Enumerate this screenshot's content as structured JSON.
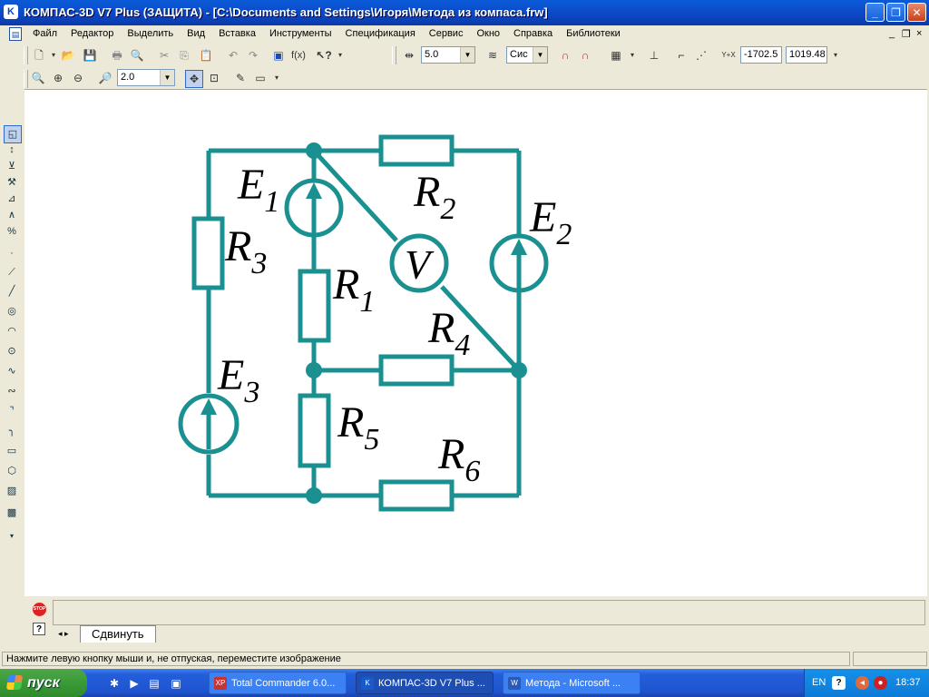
{
  "window": {
    "title": "КОМПАС-3D V7 Plus (ЗАЩИТА) - [C:\\Documents and Settings\\Игоря\\Метода из компаса.frw]",
    "app_icon": "K",
    "minimize": "_",
    "maximize": "❐",
    "close": "✕"
  },
  "menu": {
    "items": [
      "Файл",
      "Редактор",
      "Выделить",
      "Вид",
      "Вставка",
      "Инструменты",
      "Спецификация",
      "Сервис",
      "Окно",
      "Справка",
      "Библиотеки"
    ],
    "mdi_minimize": "_",
    "mdi_restore": "❐",
    "mdi_close": "×"
  },
  "toolbar1": {
    "step_value": "5.0",
    "layer_value": "Сис",
    "coord_x_label": "Y+X",
    "coord_x": "-1702.5",
    "coord_y": "1019.48",
    "fx_label": "f(x)"
  },
  "toolbar2": {
    "zoom_value": "2.0"
  },
  "circuit": {
    "line_color": "#1a9090",
    "labels": {
      "e1": "E",
      "e1_sub": "1",
      "e2": "E",
      "e2_sub": "2",
      "e3": "E",
      "e3_sub": "3",
      "r1": "R",
      "r1_sub": "1",
      "r2": "R",
      "r2_sub": "2",
      "r3": "R",
      "r3_sub": "3",
      "r4": "R",
      "r4_sub": "4",
      "r5": "R",
      "r5_sub": "5",
      "r6": "R",
      "r6_sub": "6",
      "voltmeter": "V"
    }
  },
  "command": {
    "stop_label": "STOP",
    "help_label": "?",
    "nav": "◂ ▸",
    "tab_label": "Сдвинуть"
  },
  "status": {
    "text": "Нажмите левую кнопку мыши и, не отпуская, переместите изображение"
  },
  "taskbar": {
    "start_label": "пуск",
    "tasks": [
      {
        "label": "Total Commander 6.0...",
        "icon_color": "#c83232",
        "active": false
      },
      {
        "label": "КОМПАС-3D V7 Plus ...",
        "icon_color": "#1a5ac8",
        "active": true
      },
      {
        "label": "Метода - Microsoft ...",
        "icon_color": "#2a5ab8",
        "active": false
      }
    ],
    "lang": "EN",
    "time": "18:37"
  }
}
